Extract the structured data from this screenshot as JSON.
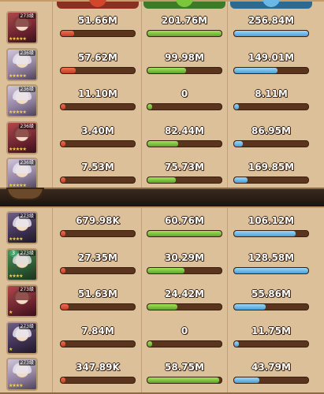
{
  "colors": {
    "damage": "#d2472c",
    "heal": "#7cc63b",
    "shield": "#6bb8e6",
    "panel": "#dcc09a"
  },
  "header_icons": [
    "damage-icon",
    "heal-icon",
    "shield-icon"
  ],
  "top_panel": {
    "rows": [
      {
        "level": "273级",
        "stars": "★★★★★",
        "hero_style": "h-red",
        "damage": "51.66M",
        "heal": "201.76M",
        "shield": "256.84M",
        "damage_ratio": 0.18,
        "heal_ratio": 1.0,
        "shield_ratio": 1.0
      },
      {
        "level": "236级",
        "stars": "★★★★★",
        "hero_style": "h-pale",
        "damage": "57.62M",
        "heal": "99.98M",
        "shield": "149.01M",
        "damage_ratio": 0.2,
        "heal_ratio": 0.52,
        "shield_ratio": 0.58
      },
      {
        "level": "236级",
        "stars": "★★★★★",
        "hero_style": "h-pale",
        "damage": "11.10M",
        "heal": "0",
        "shield": "8.11M",
        "damage_ratio": 0.0,
        "heal_ratio": 0.0,
        "shield_ratio": 0.0
      },
      {
        "level": "236级",
        "stars": "★★★★★",
        "hero_style": "h-red",
        "damage": "3.40M",
        "heal": "82.44M",
        "shield": "86.95M",
        "damage_ratio": 0.0,
        "heal_ratio": 0.42,
        "shield_ratio": 0.12
      },
      {
        "level": "236级",
        "stars": "★★★★★",
        "hero_style": "h-pale",
        "damage": "7.53M",
        "heal": "75.73M",
        "shield": "169.85M",
        "damage_ratio": 0.0,
        "heal_ratio": 0.38,
        "shield_ratio": 0.18
      }
    ]
  },
  "bottom_panel": {
    "rows": [
      {
        "level": "273级",
        "stars": "★★★★",
        "hero_style": "h-dark",
        "badge": "",
        "damage": "679.98K",
        "heal": "60.76M",
        "shield": "106.12M",
        "damage_ratio": 0.0,
        "heal_ratio": 1.0,
        "shield_ratio": 0.83
      },
      {
        "level": "273级",
        "stars": "★★★★",
        "hero_style": "h-green",
        "badge": "3",
        "damage": "27.35M",
        "heal": "30.29M",
        "shield": "128.58M",
        "damage_ratio": 0.06,
        "heal_ratio": 0.5,
        "shield_ratio": 1.0
      },
      {
        "level": "273级",
        "stars": "★",
        "hero_style": "h-red",
        "badge": "",
        "damage": "51.63M",
        "heal": "24.42M",
        "shield": "55.86M",
        "damage_ratio": 0.11,
        "heal_ratio": 0.4,
        "shield_ratio": 0.43
      },
      {
        "level": "273级",
        "stars": "★",
        "hero_style": "h-dark",
        "badge": "",
        "damage": "7.84M",
        "heal": "0",
        "shield": "11.75M",
        "damage_ratio": 0.0,
        "heal_ratio": 0.0,
        "shield_ratio": 0.03
      },
      {
        "level": "273级",
        "stars": "★★★★",
        "hero_style": "h-pale",
        "badge": "",
        "damage": "347.89K",
        "heal": "58.75M",
        "shield": "43.79M",
        "damage_ratio": 0.0,
        "heal_ratio": 0.97,
        "shield_ratio": 0.34
      }
    ]
  }
}
